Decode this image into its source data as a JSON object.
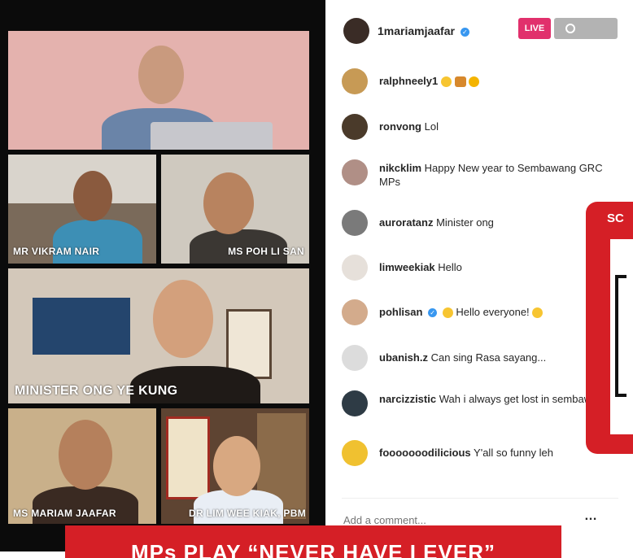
{
  "video": {
    "tiles": [
      {
        "label": ""
      },
      {
        "label": "MR VIKRAM NAIR"
      },
      {
        "label": "MS POH LI SAN"
      },
      {
        "label": "MINISTER ONG YE KUNG"
      },
      {
        "label": "MS MARIAM JAAFAR"
      },
      {
        "label": "DR LIM WEE KIAK, PBM"
      }
    ]
  },
  "header": {
    "username": "1mariamjaafar",
    "live_label": "LIVE",
    "viewers_icon": "eye-icon"
  },
  "comments": [
    {
      "user": "ralphneely1",
      "text": "",
      "emojis": [
        "grin-emoji",
        "people-emoji",
        "sun-emoji"
      ],
      "verified": false
    },
    {
      "user": "ronvong",
      "text": "Lol",
      "emojis": [],
      "verified": false
    },
    {
      "user": "nikcklim",
      "text": "Happy New year to Sembawang GRC MPs",
      "emojis": [],
      "verified": false
    },
    {
      "user": "auroratanz",
      "text": "Minister ong",
      "emojis": [],
      "verified": false
    },
    {
      "user": "limweekiak",
      "text": "Hello",
      "emojis": [],
      "verified": false
    },
    {
      "user": "pohlisan",
      "text": "Hello everyone!",
      "emojis": [
        "blush-emoji",
        "smile-emoji"
      ],
      "verified": true
    },
    {
      "user": "ubanish.z",
      "text": "Can sing Rasa sayang...",
      "emojis": [],
      "verified": false
    },
    {
      "user": "narcizzistic",
      "text": "Wah i always get lost in sembawang!",
      "emojis": [],
      "verified": false
    },
    {
      "user": "fooooooodilicious",
      "text": "Y'all so funny leh",
      "emojis": [],
      "verified": false
    }
  ],
  "composer": {
    "placeholder": "Add a comment...",
    "more_label": "…"
  },
  "side_card": {
    "heading": "SC"
  },
  "banner": {
    "text": "MPs PLAY “NEVER HAVE I EVER”"
  },
  "colors": {
    "brand_red": "#d51f26",
    "live_pink": "#e1306c",
    "verified_blue": "#3897f0"
  }
}
